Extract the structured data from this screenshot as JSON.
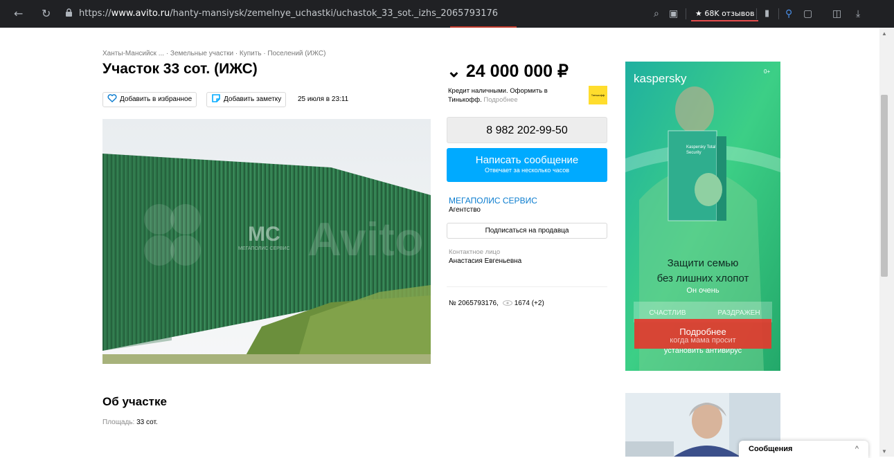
{
  "browser": {
    "url_scheme": "https://",
    "url_domain": "www.avito.ru",
    "url_path": "/hanty-mansiysk/zemelnye_uchastki/uchastok_33_sot._izhs_2065793176",
    "reviews_badge": "★ 68K отзывов"
  },
  "listing": {
    "breadcrumbs": "Ханты-Мансийск  ...  · Земельные участки · Купить · Поселений (ИЖС)",
    "title": "Участок 33 сот. (ИЖС)",
    "favorite_label": "Добавить в избранное",
    "note_label": "Добавить заметку",
    "date": "25 июля в 23:11",
    "photo_watermark": "Avito",
    "photo_logo": "MC",
    "photo_logo_caption": "МЕГАПОЛИС СЕРВИС",
    "about_title": "Об участке",
    "area_label": "Площадь:",
    "area_value": "33 сот."
  },
  "sidebar": {
    "price_chevron": "⌄",
    "price": "24 000 000 ₽",
    "credit_text": "Кредит наличными. Оформить в Тинькофф.",
    "credit_more": "Подробнее",
    "bank_logo": "Тинькофф",
    "phone": "8 982 202-99-50",
    "message_button": "Написать сообщение",
    "message_sub": "Отвечает за несколько часов",
    "seller_name": "МЕГАПОЛИС СЕРВИС",
    "seller_type": "Агентство",
    "subscribe_label": "Подписаться на продавца",
    "contact_label": "Контактное лицо",
    "contact_name": "Анастасия Евгеньевна",
    "ad_number": "№ 2065793176,",
    "views": "1674 (+2)"
  },
  "ad_banner": {
    "brand": "kaspersky",
    "age": "0+",
    "product": "Kaspersky Total Security",
    "headline1": "Защити семью",
    "headline2": "без лишних хлопот",
    "sub": "Он очень",
    "opt1": "СЧАСТЛИВ",
    "opt2": "РАЗДРАЖЕН",
    "cta": "Подробнее",
    "bottom1": "когда мама просит",
    "bottom2": "установить антивирус"
  },
  "chat": {
    "label": "Сообщения",
    "chevron": "^"
  },
  "colors": {
    "accent_blue": "#00aaff",
    "link_blue": "#0a7ccf",
    "ad_green": "#2bc08a",
    "cta_red": "#e23a2e"
  }
}
